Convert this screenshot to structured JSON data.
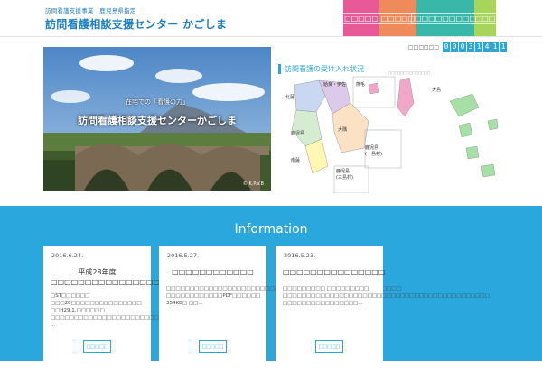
{
  "header": {
    "subtitle": "訪問看護支援事業　鹿児島県指定",
    "title": "訪問看護相談支援センター かごしま"
  },
  "nav": [
    {
      "label": "□□□□□",
      "color": "#e75a97"
    },
    {
      "label": "□□□□□",
      "color": "#ef8a5a"
    },
    {
      "label": "□□□□□□□□□",
      "color": "#39b8aa"
    },
    {
      "label": "□□□",
      "color": "#a9d45a"
    }
  ],
  "counter": {
    "label": "□□□□□□",
    "digits": [
      "0",
      "0",
      "0",
      "3",
      "1",
      "4",
      "1",
      "1"
    ]
  },
  "hero": {
    "caption_small": "在宅での「看護の力」",
    "caption_main": "訪問看護相談支援センターかごしま",
    "credit": "© K.P.V.B"
  },
  "map": {
    "title": "訪問看護の受け入れ状況",
    "note": "□□□□□□□□□□□□□□",
    "labels": {
      "hokusatsu": "北薩",
      "aira_isa": "姶良・伊佐",
      "kumage": "熊毛",
      "kagoshima": "鹿児島",
      "osumi": "大隅",
      "oshima": "大島",
      "nansatsu": "南薩",
      "kagoshima_toshima": "鹿児島\n(十島村)",
      "kagoshima_mishima": "鹿児島\n(三島村)"
    }
  },
  "info": {
    "title": "Information",
    "cards": [
      {
        "date": "2016.6.24.",
        "title": "平成28年度 □□□□□□□□□□□□□□□□□",
        "excerpt": "□ST□□□□□□ □□□28□□□□□□□□□□□□□□□ □□H29.1.□□□□□□ □□□□□□□□□□□□□□□□□□□□□□□□□□□□□□□□□□□□□□□□□□□□ …",
        "button": "□□□□□"
      },
      {
        "date": "2016.5.27.",
        "title": "□□□□□□□□□□□□",
        "excerpt": "□□□□□□□□□□□□□□□□□□□□□□□□□□□□□□□□□□□□□□□□□□□□□□□□□□ □□□□□□□□□□□□PDF□□□□□□ 354KB□ □□…",
        "button": "□□□□□"
      },
      {
        "date": "2016.5.23.",
        "title": "□□□□□□□□□□□□□□□",
        "excerpt": "□□□□□□□□□ □□□□□□□□□ □□□□□□□□□□□□□□□□□□□□□□□□□□□□□□□□□□□□□□□□□□□□ □□□□□□□□□□□□□□□□…",
        "button": "□□□□□"
      }
    ]
  }
}
